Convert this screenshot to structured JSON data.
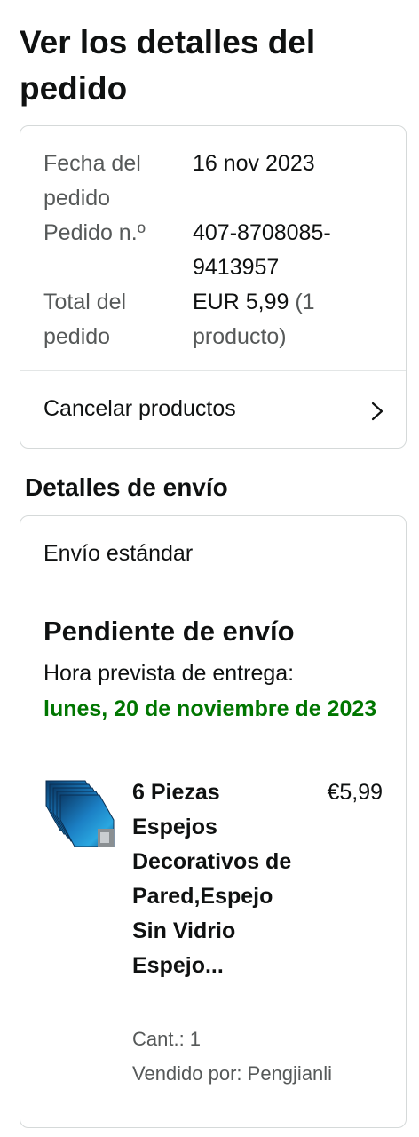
{
  "page": {
    "title": "Ver los detalles del pedido"
  },
  "order_summary": {
    "date_label": "Fecha del pedido",
    "date_value": "16 nov 2023",
    "number_label": "Pedido n.º",
    "number_value": "407-8708085-9413957",
    "total_label": "Total del pedido",
    "total_amount": "EUR 5,99",
    "total_count": " (1 producto)",
    "cancel_label": "Cancelar productos",
    "cancel_icon": "chevron-right-icon"
  },
  "shipping": {
    "section_title": "Detalles de envío",
    "method": "Envío estándar",
    "status": "Pendiente de envío",
    "eta_label": "Hora prevista de entrega:",
    "eta_date": "lunes, 20 de noviembre de 2023",
    "eta_color": "#007600"
  },
  "product": {
    "title": "6 Piezas Espejos Decorativos de Pared,Espejo Sin Vidrio Espejo...",
    "price": "€5,99",
    "quantity": "Cant.: 1",
    "seller": "Vendido por: Pengjianli",
    "thumbnail": "product-thumbnail-blue-mirror-sheets"
  }
}
